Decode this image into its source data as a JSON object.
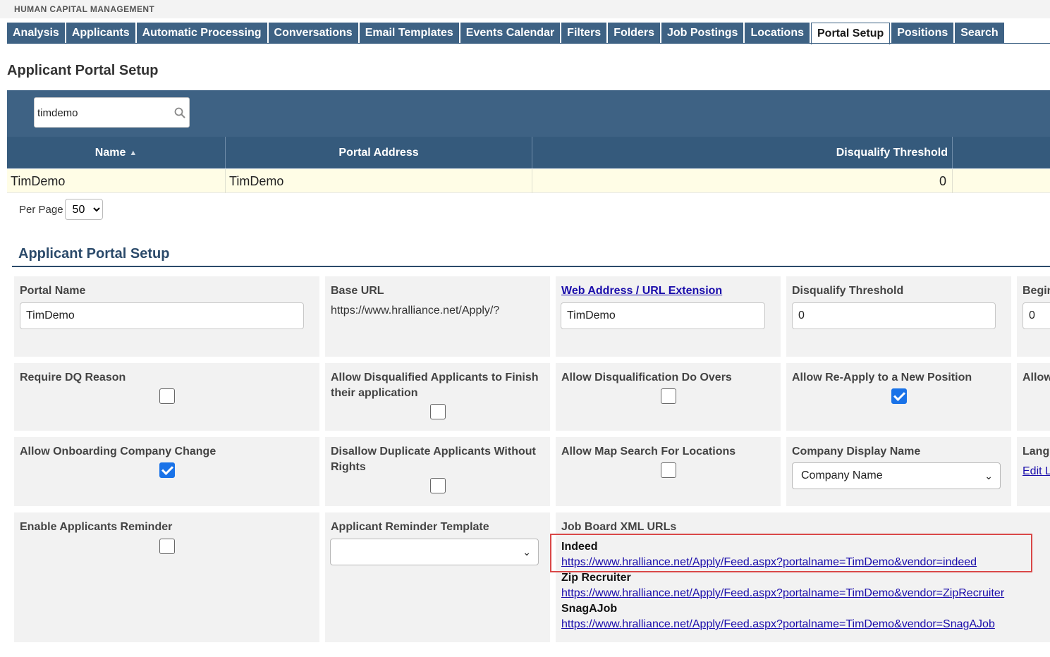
{
  "header": {
    "brand": "HUMAN CAPITAL MANAGEMENT"
  },
  "tabs": [
    {
      "label": "Analysis"
    },
    {
      "label": "Applicants"
    },
    {
      "label": "Automatic Processing"
    },
    {
      "label": "Conversations"
    },
    {
      "label": "Email Templates"
    },
    {
      "label": "Events Calendar"
    },
    {
      "label": "Filters"
    },
    {
      "label": "Folders"
    },
    {
      "label": "Job Postings"
    },
    {
      "label": "Locations"
    },
    {
      "label": "Portal Setup",
      "active": true
    },
    {
      "label": "Positions"
    },
    {
      "label": "Search"
    }
  ],
  "page_title": "Applicant Portal Setup",
  "grid": {
    "search_value": "timdemo",
    "columns": [
      "Name",
      "Portal Address",
      "Disqualify Threshold"
    ],
    "rows": [
      {
        "name": "TimDemo",
        "portal_address": "TimDemo",
        "disqualify_threshold": "0"
      }
    ],
    "per_page_label": "Per Page",
    "per_page_value": "50"
  },
  "form": {
    "section_title": "Applicant Portal Setup",
    "portal_name_label": "Portal Name",
    "portal_name_value": "TimDemo",
    "base_url_label": "Base URL",
    "base_url_value": "https://www.hralliance.net/Apply/?",
    "web_address_label": "Web Address / URL Extension",
    "web_address_value": "TimDemo",
    "dq_threshold_label": "Disqualify Threshold",
    "dq_threshold_value": "0",
    "begin_label": "Begin",
    "begin_value": "0",
    "require_dq_reason_label": "Require DQ Reason",
    "allow_dq_finish_label": "Allow Disqualified Applicants to Finish their application",
    "allow_dq_doovers_label": "Allow Disqualification Do Overs",
    "allow_reapply_label": "Allow Re-Apply to a New Position",
    "allow_col5_label": "Allow",
    "allow_onboarding_label": "Allow Onboarding Company Change",
    "disallow_duplicate_label": "Disallow Duplicate Applicants Without Rights",
    "allow_map_search_label": "Allow Map Search For Locations",
    "company_display_label": "Company Display Name",
    "company_display_value": "Company Name",
    "lang_label": "Lang",
    "edit_link": "Edit L",
    "enable_reminder_label": "Enable Applicants Reminder",
    "reminder_template_label": "Applicant Reminder Template",
    "reminder_template_value": "",
    "job_board_label": "Job Board XML URLs",
    "job_boards": [
      {
        "name": "Indeed",
        "url": "https://www.hralliance.net/Apply/Feed.aspx?portalname=TimDemo&vendor=indeed"
      },
      {
        "name": "Zip Recruiter",
        "url": "https://www.hralliance.net/Apply/Feed.aspx?portalname=TimDemo&vendor=ZipRecruiter"
      },
      {
        "name": "SnagAJob",
        "url": "https://www.hralliance.net/Apply/Feed.aspx?portalname=TimDemo&vendor=SnagAJob"
      }
    ]
  },
  "checkbox_states": {
    "require_dq_reason": false,
    "allow_dq_finish": false,
    "allow_dq_doovers": false,
    "allow_reapply": true,
    "allow_onboarding": true,
    "disallow_duplicate": false,
    "allow_map_search": false,
    "enable_reminder": false
  },
  "colors": {
    "nav": "#3e6284",
    "header": "#355a7c",
    "accent": "#1a73e8",
    "highlight": "#d94848"
  }
}
